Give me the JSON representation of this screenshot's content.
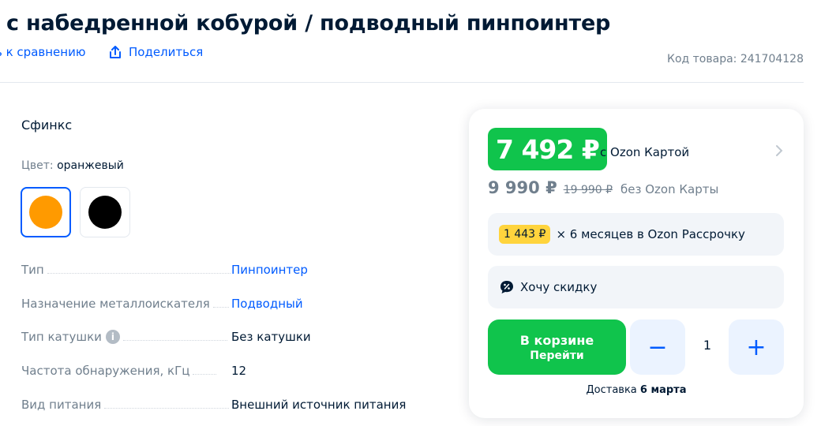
{
  "product": {
    "title": "с набедренной кобурой / подводный пинпоинтер",
    "compare_label": "ь к сравнению",
    "share_label": "Поделиться",
    "sku_label": "Код товара: 241704128"
  },
  "variants": {
    "brand": "Сфинкс",
    "color_label": "Цвет:",
    "color_value": "оранжевый",
    "swatches": [
      {
        "name": "orange",
        "color": "#ff9a00",
        "selected": true
      },
      {
        "name": "black",
        "color": "#000000",
        "selected": false
      }
    ]
  },
  "specs": [
    {
      "key": "Тип",
      "value": "Пинпоинтер",
      "link": true
    },
    {
      "key": "Назначение металлоискателя",
      "value": "Подводный",
      "link": true
    },
    {
      "key": "Тип катушки",
      "value": "Без катушки",
      "link": false,
      "info": "i"
    },
    {
      "key": "Частота обнаружения, кГц",
      "value": "12",
      "link": false
    },
    {
      "key": "Вид питания",
      "value": "Внешний источник питания",
      "link": false
    }
  ],
  "price": {
    "card_price": "7 492 ₽",
    "card_caption": "с Ozon Картой",
    "price": "9 990 ₽",
    "old_price": "19 990 ₽",
    "no_card_caption": "без Ozon Карты",
    "installment_amount": "1 443 ₽",
    "installment_text": "× 6 месяцев в Ozon Рассрочку",
    "discount_text": "Хочу скидку",
    "cart_label": "В корзине",
    "cart_sub": "Перейти",
    "minus": "−",
    "plus": "+",
    "quantity": "1",
    "delivery_prefix": "Доставка",
    "delivery_date": "6 марта"
  },
  "colors": {
    "accent": "#005bff",
    "green": "#10c44c",
    "yellow": "#ffd43d"
  }
}
